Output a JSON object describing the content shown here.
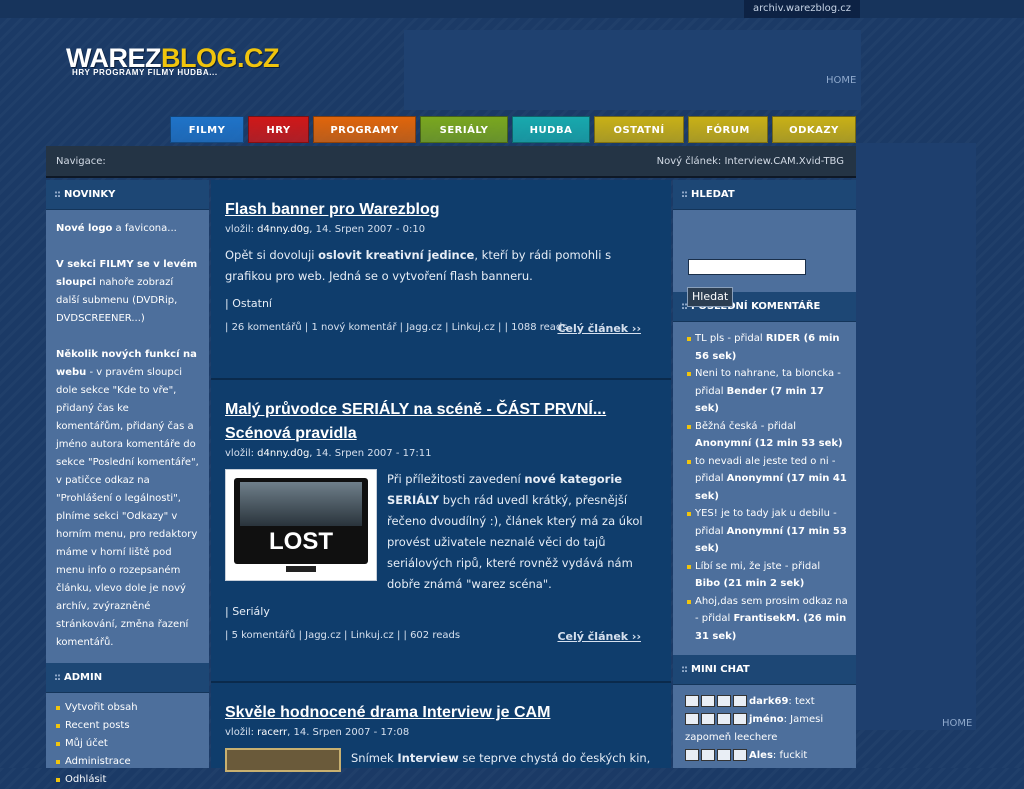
{
  "archive_link": "archiv.warezblog.cz",
  "logo": {
    "part1": "WAREZ",
    "part2": "BLOG.CZ",
    "tagline": "HRY PROGRAMY FILMY HUDBA..."
  },
  "home_label": "HOME",
  "tabs": [
    {
      "label": "FILMY",
      "color": "#1f73c8"
    },
    {
      "label": "HRY",
      "color": "#d01818"
    },
    {
      "label": "PROGRAMY",
      "color": "#e0650a"
    },
    {
      "label": "SERIÁLY",
      "color": "#7aa71e"
    },
    {
      "label": "HUDBA",
      "color": "#18a9ad"
    },
    {
      "label": "OSTATNÍ",
      "color": "#c9b016"
    },
    {
      "label": "FÓRUM",
      "color": "#c9b016"
    },
    {
      "label": "ODKAZY",
      "color": "#c9b016"
    }
  ],
  "nav": {
    "label": "Navigace:",
    "latest": "Nový článek: Interview.CAM.Xvid-TBG"
  },
  "left": {
    "novinky_title": "NOVINKY",
    "novinky": {
      "p1_bold": "Nové logo",
      "p1_rest": " a favicona...",
      "p2_bold": "V sekci FILMY se v levém sloupci",
      "p2_rest": " nahoře zobrazí další submenu (DVDRip, DVDSCREENER...)",
      "p3_bold": "Několik nových funkcí na webu",
      "p3_rest": " - v pravém sloupci dole sekce \"Kde to vře\", přidaný čas ke komentářům, přidaný čas a jméno autora komentáře do sekce \"Poslední komentáře\", v patičce odkaz na \"Prohlášení o legálnosti\", plníme sekci \"Odkazy\" v horním menu, pro redaktory máme v horní liště pod menu info o rozepsaném článku, vlevo dole je nový archív, zvýrazněné stránkování, změna řazení komentářů."
    },
    "admin_title": "ADMIN",
    "admin_items": [
      "Vytvořit obsah",
      "Recent posts",
      "Můj účet",
      "Administrace",
      "Odhlásit"
    ]
  },
  "articles": [
    {
      "title": "Flash banner pro Warezblog",
      "meta_prefix": "vložil: ",
      "author": "d4nny.d0g",
      "date": ", 14. Srpen 2007 - 0:10",
      "body_a": "Opět si dovoluji ",
      "body_bold": "oslovit kreativní jedince",
      "body_b": ", kteří by rádi pomohli s grafikou pro web. Jedná se o vytvoření flash banneru.",
      "category": "| Ostatní",
      "links": [
        "26 komentářů",
        "1 nový komentář",
        "Jagg.cz",
        "Linkuj.cz"
      ],
      "reads": "| 1088 reads",
      "full": "Celý článek ››"
    },
    {
      "title": "Malý průvodce SERIÁLY na scéně - ČÁST PRVNÍ... Scénová pravidla",
      "meta_prefix": "vložil: ",
      "author": "d4nny.d0g",
      "date": ", 14. Srpen 2007 - 17:11",
      "thumb_text": "LOST",
      "body_a": "Při příležitosti zavedení ",
      "body_bold": "nové kategorie SERIÁLY",
      "body_b": " bych rád uvedl krátký, přesnější řečeno dvoudílný :), článek který má za úkol provést uživatele neznalé věci do tajů seriálových ripů, které rovněž vydává nám dobře známá \"warez scéna\".",
      "category": "| Seriály",
      "links": [
        "5 komentářů",
        "Jagg.cz",
        "Linkuj.cz"
      ],
      "reads": "| 602 reads",
      "full": "Celý článek ››"
    },
    {
      "title": "Skvěle hodnocené drama Interview je CAM",
      "meta_prefix": "vložil: ",
      "author": "racerr",
      "date": ", 14. Srpen 2007 - 17:08",
      "body_a": "Snímek ",
      "body_bold": "Interview",
      "body_b": " se teprve chystá do českých kin,"
    }
  ],
  "right": {
    "search_title": "HLEDAT",
    "search_button": "Hledat",
    "comments_title": "POSLEDNÍ KOMENTÁŘE",
    "comments": [
      {
        "link": "TL pls",
        "mid": " - přidal ",
        "who": "RIDER (6 min 56 sek)"
      },
      {
        "link": "Neni to nahrane, ta bloncka",
        "mid": " - přidal ",
        "who": "Bender (7 min 17 sek)"
      },
      {
        "link": "Běžná česká",
        "mid": " - přidal ",
        "who": "Anonymní (12 min 53 sek)"
      },
      {
        "link": "to nevadi ale jeste ted o ni",
        "mid": " - přidal ",
        "who": "Anonymní (17 min 41 sek)"
      },
      {
        "link": "YES! je to tady jak u debilu",
        "mid": " - přidal ",
        "who": "Anonymní (17 min 53 sek)"
      },
      {
        "link": "Líbí se mi, že jste",
        "mid": " - přidal ",
        "who": "Bibo (21 min 2 sek)"
      },
      {
        "link": "Ahoj,das sem prosim odkaz na",
        "mid": " - přidal ",
        "who": "FrantisekM. (26 min 31 sek)"
      }
    ],
    "chat_title": "MINI CHAT",
    "chat": [
      {
        "name": "dark69",
        "text": ": text"
      },
      {
        "name": "jméno",
        "text": ": Jamesi zapomeň leechere"
      },
      {
        "name": "Ales",
        "text": ": fuckit"
      }
    ]
  }
}
